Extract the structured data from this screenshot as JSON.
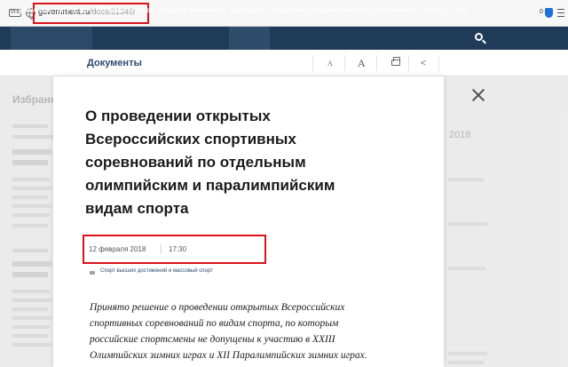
{
  "browser": {
    "vpn_label": "VPN",
    "url_host": "government.ru",
    "url_path": "/docs/31345/",
    "ext_badge": "0"
  },
  "nav": {
    "items": [
      {
        "label": "Правительство России"
      },
      {
        "label": "О Правительстве"
      },
      {
        "label": "Новости"
      },
      {
        "label": "Заседания"
      },
      {
        "label": "Документы"
      },
      {
        "label": "Поручения"
      },
      {
        "label": "Законопроектная деятельность"
      },
      {
        "label": "Отчёты"
      },
      {
        "label": "Eng"
      }
    ],
    "active": "Документы"
  },
  "subheader": {
    "title": "Документы",
    "font_small": "A",
    "font_large": "A"
  },
  "background": {
    "title": "Избранн",
    "year": "2018"
  },
  "document": {
    "title_lines": [
      "О проведении открытых",
      "Всероссийских спортивных",
      "соревнований по отдельным",
      "олимпийским и паралимпийским",
      "видам спорта"
    ],
    "date": "12 февраля 2018",
    "time": "17:30",
    "tag": "Спорт высших достижений и массовый спорт",
    "lead_lines": [
      "Принято решение о проведении открытых Всероссийских",
      "спортивных соревнований по видам спорта, по которым",
      "российские спортсмены не допущены к участию в XXIII",
      "Олимпийских зимних играх и XII Паралимпийских зимних играх."
    ]
  },
  "colors": {
    "nav_bg": "#1f3b58",
    "accent": "#2b4a70",
    "highlight": "#d8121b"
  }
}
